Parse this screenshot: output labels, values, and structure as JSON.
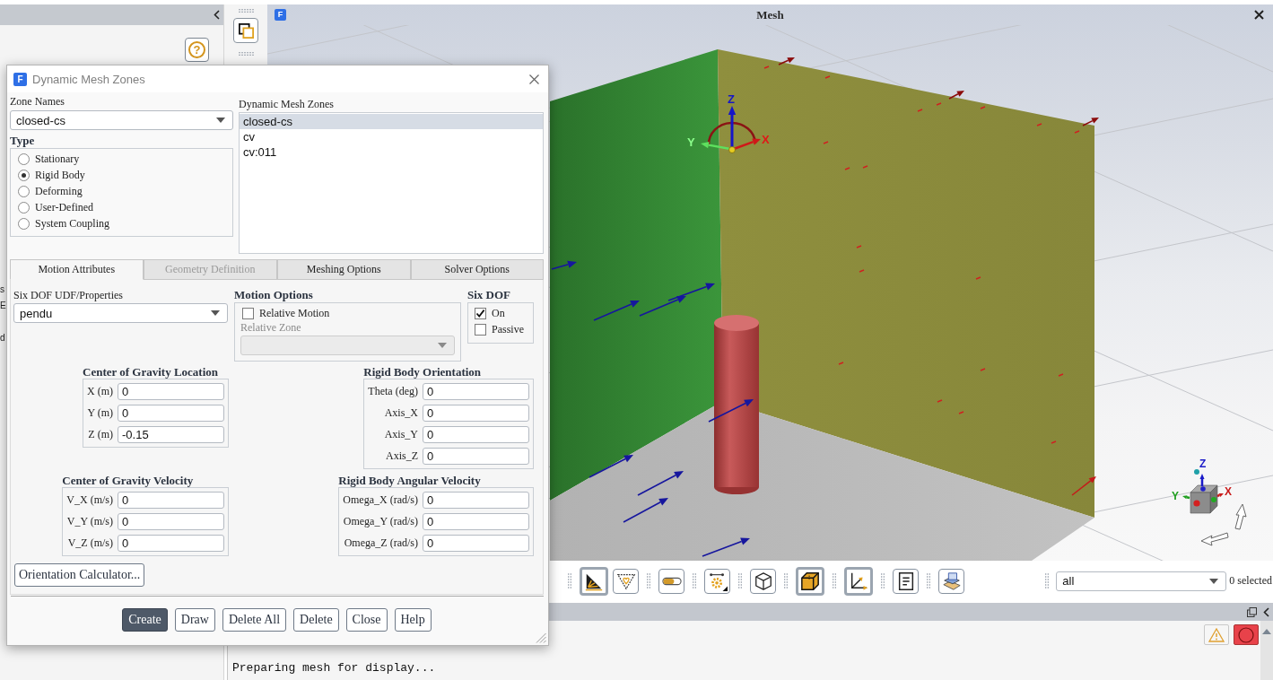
{
  "left_panel": {
    "help_glyph": "?",
    "fragments": [
      "s",
      "E",
      "d"
    ]
  },
  "mesh_view": {
    "logo": "F",
    "title": "Mesh",
    "triad_labels": {
      "x": "X",
      "y": "Y",
      "z": "Z"
    },
    "cube_labels": {
      "x": "X",
      "y": "Y",
      "z": "Z"
    }
  },
  "toolbar": {
    "groups": [
      [
        {
          "kind": "shading",
          "selected": true
        },
        {
          "kind": "edges",
          "selected": false
        }
      ],
      [
        {
          "kind": "slider",
          "selected": false
        }
      ],
      [
        {
          "kind": "gears",
          "selected": false
        }
      ],
      [
        {
          "kind": "wireframe",
          "selected": false
        }
      ],
      [
        {
          "kind": "solid",
          "selected": true
        }
      ],
      [
        {
          "kind": "axes",
          "selected": true
        }
      ],
      [
        {
          "kind": "notes",
          "selected": false
        }
      ],
      [
        {
          "kind": "layers",
          "selected": false
        }
      ]
    ],
    "selection": {
      "value": "all",
      "count": "0 selected"
    }
  },
  "console": {
    "lines": [
      "Preparing mesh for display..."
    ]
  },
  "dialog": {
    "logo": "F",
    "title": "Dynamic Mesh Zones",
    "zone_names": {
      "label": "Zone Names",
      "value": "closed-cs"
    },
    "type": {
      "label": "Type",
      "options": [
        {
          "label": "Stationary",
          "selected": false
        },
        {
          "label": "Rigid Body",
          "selected": true
        },
        {
          "label": "Deforming",
          "selected": false
        },
        {
          "label": "User-Defined",
          "selected": false
        },
        {
          "label": "System Coupling",
          "selected": false
        }
      ]
    },
    "zones_list": {
      "label": "Dynamic Mesh Zones",
      "items": [
        {
          "label": "closed-cs",
          "selected": true
        },
        {
          "label": "cv",
          "selected": false
        },
        {
          "label": "cv:011",
          "selected": false
        }
      ]
    },
    "tabs": [
      {
        "label": "Motion Attributes",
        "selected": true,
        "disabled": false
      },
      {
        "label": "Geometry Definition",
        "selected": false,
        "disabled": true
      },
      {
        "label": "Meshing Options",
        "selected": false,
        "disabled": false
      },
      {
        "label": "Solver Options",
        "selected": false,
        "disabled": false
      }
    ],
    "udf": {
      "label": "Six DOF UDF/Properties",
      "value": "pendu"
    },
    "motion_options": {
      "label": "Motion Options",
      "relative_motion": {
        "label": "Relative Motion",
        "checked": false
      },
      "relative_zone": {
        "label": "Relative Zone",
        "disabled": true
      }
    },
    "six_dof": {
      "label": "Six DOF",
      "options": [
        {
          "label": "On",
          "checked": true
        },
        {
          "label": "Passive",
          "checked": false
        }
      ]
    },
    "groups": [
      {
        "title": "Center of Gravity Location",
        "fields": [
          {
            "label": "X (m)",
            "value": "0"
          },
          {
            "label": "Y (m)",
            "value": "0"
          },
          {
            "label": "Z (m)",
            "value": "-0.15"
          }
        ]
      },
      {
        "title": "Rigid Body Orientation",
        "fields": [
          {
            "label": "Theta (deg)",
            "value": "0"
          },
          {
            "label": "Axis_X",
            "value": "0"
          },
          {
            "label": "Axis_Y",
            "value": "0"
          },
          {
            "label": "Axis_Z",
            "value": "0"
          }
        ]
      },
      {
        "title": "Center of Gravity Velocity",
        "fields": [
          {
            "label": "V_X (m/s)",
            "value": "0"
          },
          {
            "label": "V_Y (m/s)",
            "value": "0"
          },
          {
            "label": "V_Z (m/s)",
            "value": "0"
          }
        ]
      },
      {
        "title": "Rigid Body Angular Velocity",
        "fields": [
          {
            "label": "Omega_X (rad/s)",
            "value": "0"
          },
          {
            "label": "Omega_Y (rad/s)",
            "value": "0"
          },
          {
            "label": "Omega_Z (rad/s)",
            "value": "0"
          }
        ]
      }
    ],
    "orientation_button": "Orientation Calculator...",
    "buttons": [
      {
        "label": "Create",
        "primary": true
      },
      {
        "label": "Draw",
        "primary": false
      },
      {
        "label": "Delete All",
        "primary": false
      },
      {
        "label": "Delete",
        "primary": false
      },
      {
        "label": "Close",
        "primary": false
      },
      {
        "label": "Help",
        "primary": false
      }
    ]
  }
}
